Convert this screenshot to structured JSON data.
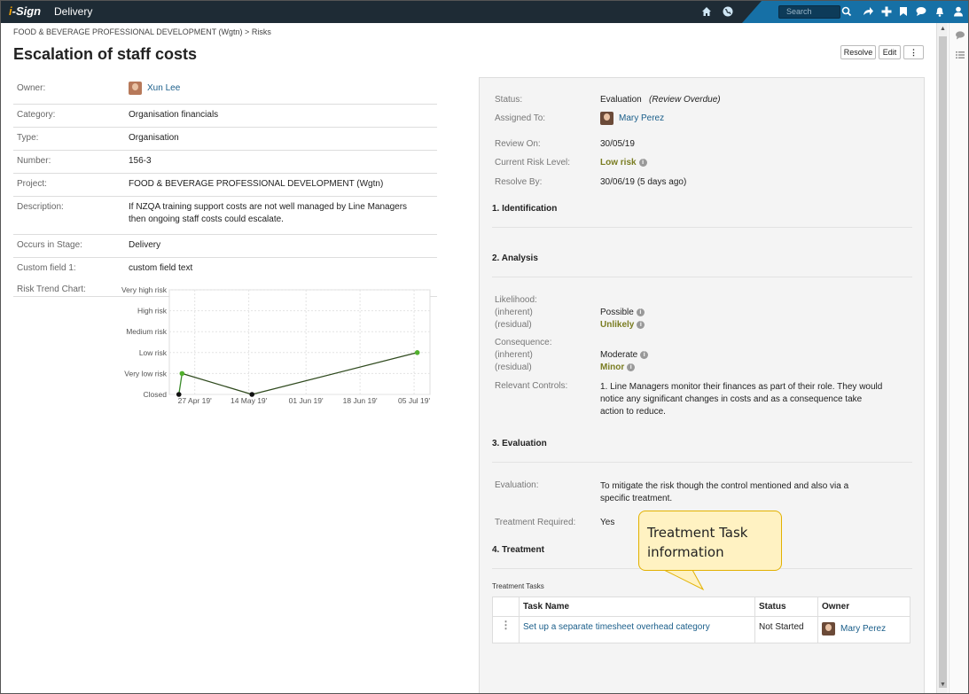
{
  "topbar": {
    "logo_prefix": "i",
    "logo_rest": "-Sign",
    "app_name": "Delivery",
    "search_placeholder": "Search",
    "icons": [
      "home-icon",
      "globe-icon",
      "share-icon",
      "plus-icon",
      "bookmark-icon",
      "chat-icon",
      "bell-icon",
      "user-icon"
    ]
  },
  "breadcrumb": "FOOD & BEVERAGE PROFESSIONAL DEVELOPMENT (Wgtn) > Risks",
  "page_title": "Escalation of staff costs",
  "actions": {
    "resolve": "Resolve",
    "edit": "Edit",
    "more": "⋮"
  },
  "properties": {
    "owner_label": "Owner:",
    "owner_value": "Xun Lee",
    "category_label": "Category:",
    "category_value": "Organisation financials",
    "type_label": "Type:",
    "type_value": "Organisation",
    "number_label": "Number:",
    "number_value": "156-3",
    "project_label": "Project:",
    "project_value": "FOOD & BEVERAGE PROFESSIONAL DEVELOPMENT (Wgtn)",
    "description_label": "Description:",
    "description_value": "If NZQA training support costs are not well managed by Line Managers then ongoing staff costs could escalate.",
    "stage_label": "Occurs in Stage:",
    "stage_value": "Delivery",
    "custom_label": "Custom field 1:",
    "custom_value": "custom field text",
    "chart_label": "Risk Trend Chart:"
  },
  "chart_data": {
    "type": "line",
    "y_categories": [
      "Closed",
      "Very low risk",
      "Low risk",
      "Medium risk",
      "High risk",
      "Very high risk"
    ],
    "x_ticks": [
      "27 Apr 19'",
      "14 May 19'",
      "01 Jun 19'",
      "18 Jun 19'",
      "05 Jul 19'"
    ],
    "series": [
      {
        "points": [
          {
            "x": "2019-04-22",
            "y": "Closed"
          },
          {
            "x": "2019-04-23",
            "y": "Very low risk"
          },
          {
            "x": "2019-05-15",
            "y": "Closed"
          },
          {
            "x": "2019-07-06",
            "y": "Low risk"
          }
        ]
      }
    ]
  },
  "panel": {
    "status_label": "Status:",
    "status_value": "Evaluation",
    "status_note": "(Review Overdue)",
    "assigned_label": "Assigned To:",
    "assigned_value": "Mary Perez",
    "review_label": "Review On:",
    "review_value": "30/05/19",
    "risklevel_label": "Current Risk Level:",
    "risklevel_value": "Low risk",
    "resolve_label": "Resolve By:",
    "resolve_value": "30/06/19 (5 days ago)",
    "sec1": "1. Identification",
    "sec2": "2. Analysis",
    "likelihood_label": "Likelihood:",
    "inherent_label": "(inherent)",
    "residual_label": "(residual)",
    "likelihood_inherent": "Possible",
    "likelihood_residual": "Unlikely",
    "consequence_label": "Consequence:",
    "consequence_inherent": "Moderate",
    "consequence_residual": "Minor",
    "controls_label": "Relevant Controls:",
    "controls_value": "1. Line Managers monitor their finances as part of their role. They would notice any significant changes in costs and as a consequence take action to reduce.",
    "sec3": "3. Evaluation",
    "evaluation_label": "Evaluation:",
    "evaluation_value": "To mitigate the risk though the control mentioned and also via a specific treatment.",
    "treatment_req_label": "Treatment Required:",
    "treatment_req_value": "Yes",
    "sec4": "4. Treatment",
    "tasks_label": "Treatment Tasks",
    "tasks_headers": {
      "name": "Task Name",
      "status": "Status",
      "owner": "Owner"
    },
    "tasks": [
      {
        "name": "Set up a separate timesheet overhead category",
        "status": "Not Started",
        "owner": "Mary Perez"
      }
    ]
  },
  "callout": {
    "line1": "Treatment Task",
    "line2": "information"
  },
  "colors": {
    "topbar": "#1e2b35",
    "accent": "#1670a6",
    "link": "#1a5e8a",
    "olive": "#7a7d22",
    "callout_bg": "#fff2c2",
    "callout_border": "#e2b100"
  }
}
